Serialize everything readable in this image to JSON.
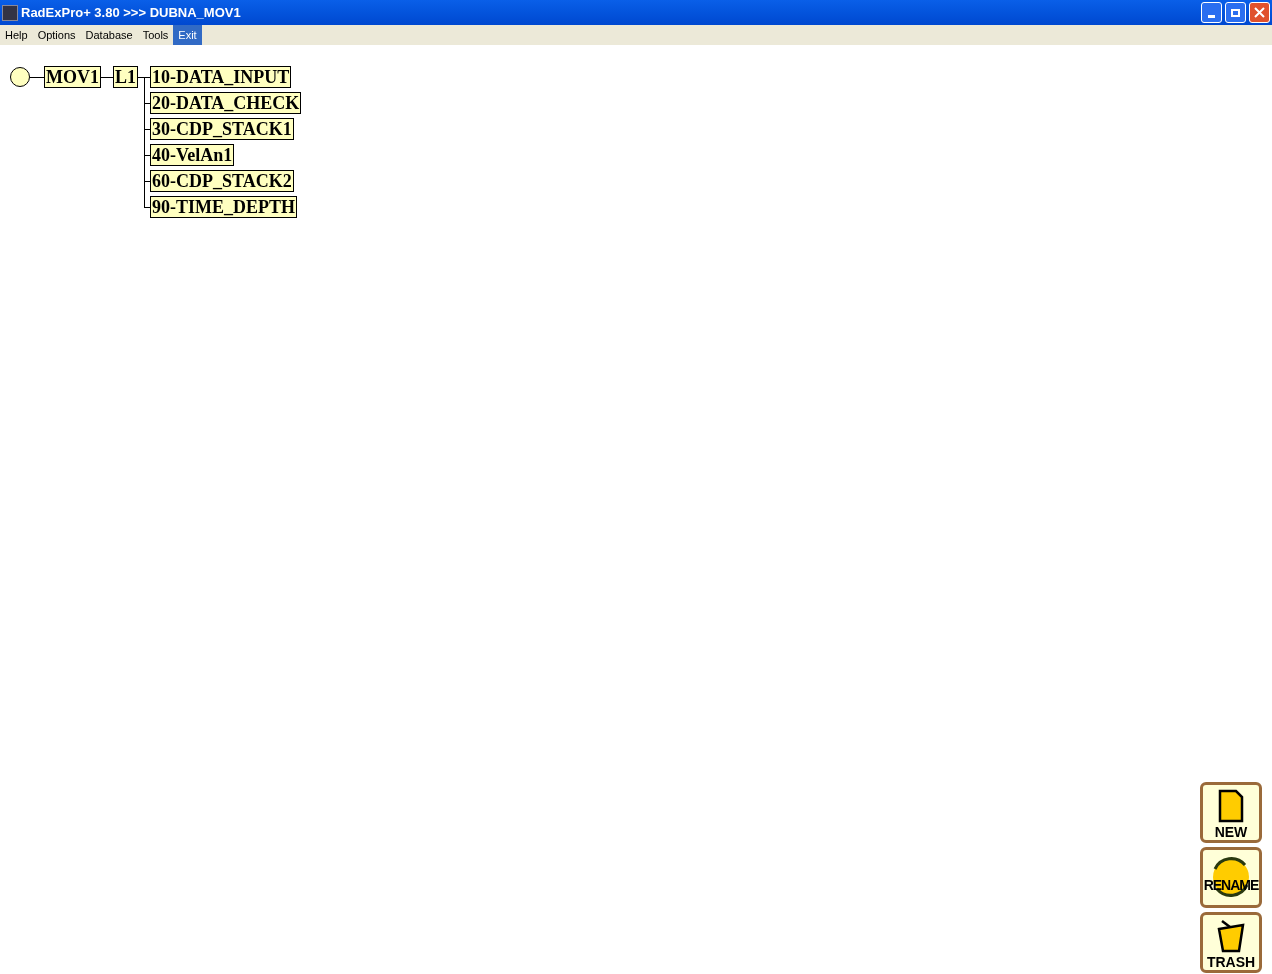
{
  "window": {
    "title": "RadExPro+ 3.80 >>> DUBNA_MOV1"
  },
  "menu": [
    {
      "label": "Help",
      "selected": false
    },
    {
      "label": "Options",
      "selected": false
    },
    {
      "label": "Database",
      "selected": false
    },
    {
      "label": "Tools",
      "selected": false
    },
    {
      "label": "Exit",
      "selected": true
    }
  ],
  "tree": {
    "label": "MOV1",
    "children": [
      {
        "label": "L1",
        "children": [
          {
            "label": "10-DATA_INPUT"
          },
          {
            "label": "20-DATA_CHECK"
          },
          {
            "label": "30-CDP_STACK1"
          },
          {
            "label": "40-VelAn1"
          },
          {
            "label": "60-CDP_STACK2"
          },
          {
            "label": "90-TIME_DEPTH"
          }
        ]
      }
    ]
  },
  "actions": [
    {
      "kind": "new",
      "label": "NEW"
    },
    {
      "kind": "rename",
      "label": "RENAME"
    },
    {
      "kind": "trash",
      "label": "TRASH"
    }
  ]
}
